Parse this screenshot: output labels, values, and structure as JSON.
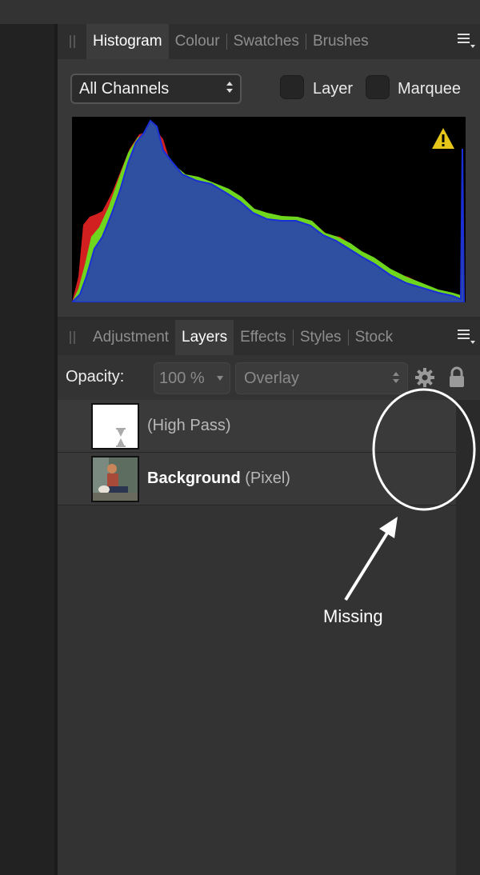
{
  "histogram_panel": {
    "tabs": [
      "Histogram",
      "Colour",
      "Swatches",
      "Brushes"
    ],
    "active_tab": "Histogram",
    "channel_select": "All Channels",
    "checkboxes": [
      {
        "label": "Layer",
        "checked": false
      },
      {
        "label": "Marquee",
        "checked": false
      }
    ],
    "warning_icon": "warning-triangle-icon"
  },
  "layers_panel": {
    "tabs": [
      "Adjustment",
      "Layers",
      "Effects",
      "Styles",
      "Stock"
    ],
    "active_tab": "Layers",
    "opacity_label": "Opacity:",
    "opacity_value": "100 %",
    "blend_mode": "Overlay",
    "layers": [
      {
        "name": "",
        "type": "(High Pass)",
        "thumb": "high-pass-thumbnail"
      },
      {
        "name": "Background",
        "type": "(Pixel)",
        "thumb": "photo-thumbnail"
      }
    ]
  },
  "annotation": {
    "text": "Missing",
    "color": "#ffffff"
  },
  "colors": {
    "histogram_red": "#d21f1f",
    "histogram_green": "#6fd61e",
    "histogram_blue": "#1b2fd6",
    "histogram_fill": "#2f4fa0"
  }
}
